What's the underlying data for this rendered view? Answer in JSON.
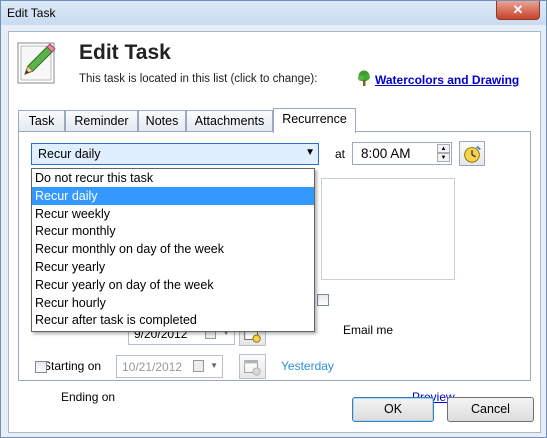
{
  "window": {
    "title": "Edit Task",
    "close_glyph": "✕"
  },
  "header": {
    "title": "Edit Task",
    "list_info": "This task is located in this list (click to change):",
    "list_name": "Watercolors and Drawing"
  },
  "tabs": [
    {
      "label": "Task",
      "active": false
    },
    {
      "label": "Reminder",
      "active": false
    },
    {
      "label": "Notes",
      "active": false
    },
    {
      "label": "Attachments",
      "active": false
    },
    {
      "label": "Recurrence",
      "active": true
    }
  ],
  "recurrence": {
    "selected": "Recur daily",
    "at_label": "at",
    "time": "8:00 AM",
    "options": [
      "Do not recur this task",
      "Recur daily",
      "Recur weekly",
      "Recur monthly",
      "Recur monthly on day of the week",
      "Recur yearly",
      "Recur yearly on day of the week",
      "Recur hourly",
      "Recur after task is completed"
    ],
    "selected_index": 1,
    "email_label": "Email me",
    "starting_label": "Starting on",
    "starting_date": "9/20/2012",
    "starting_hint": "Yesterday",
    "ending_label": "Ending on",
    "ending_date": "10/21/2012",
    "preview_label": "Preview"
  },
  "buttons": {
    "ok": "OK",
    "cancel": "Cancel"
  },
  "colors": {
    "accent": "#3399ff",
    "link": "#0000cc",
    "hint": "#2a8fd6"
  }
}
